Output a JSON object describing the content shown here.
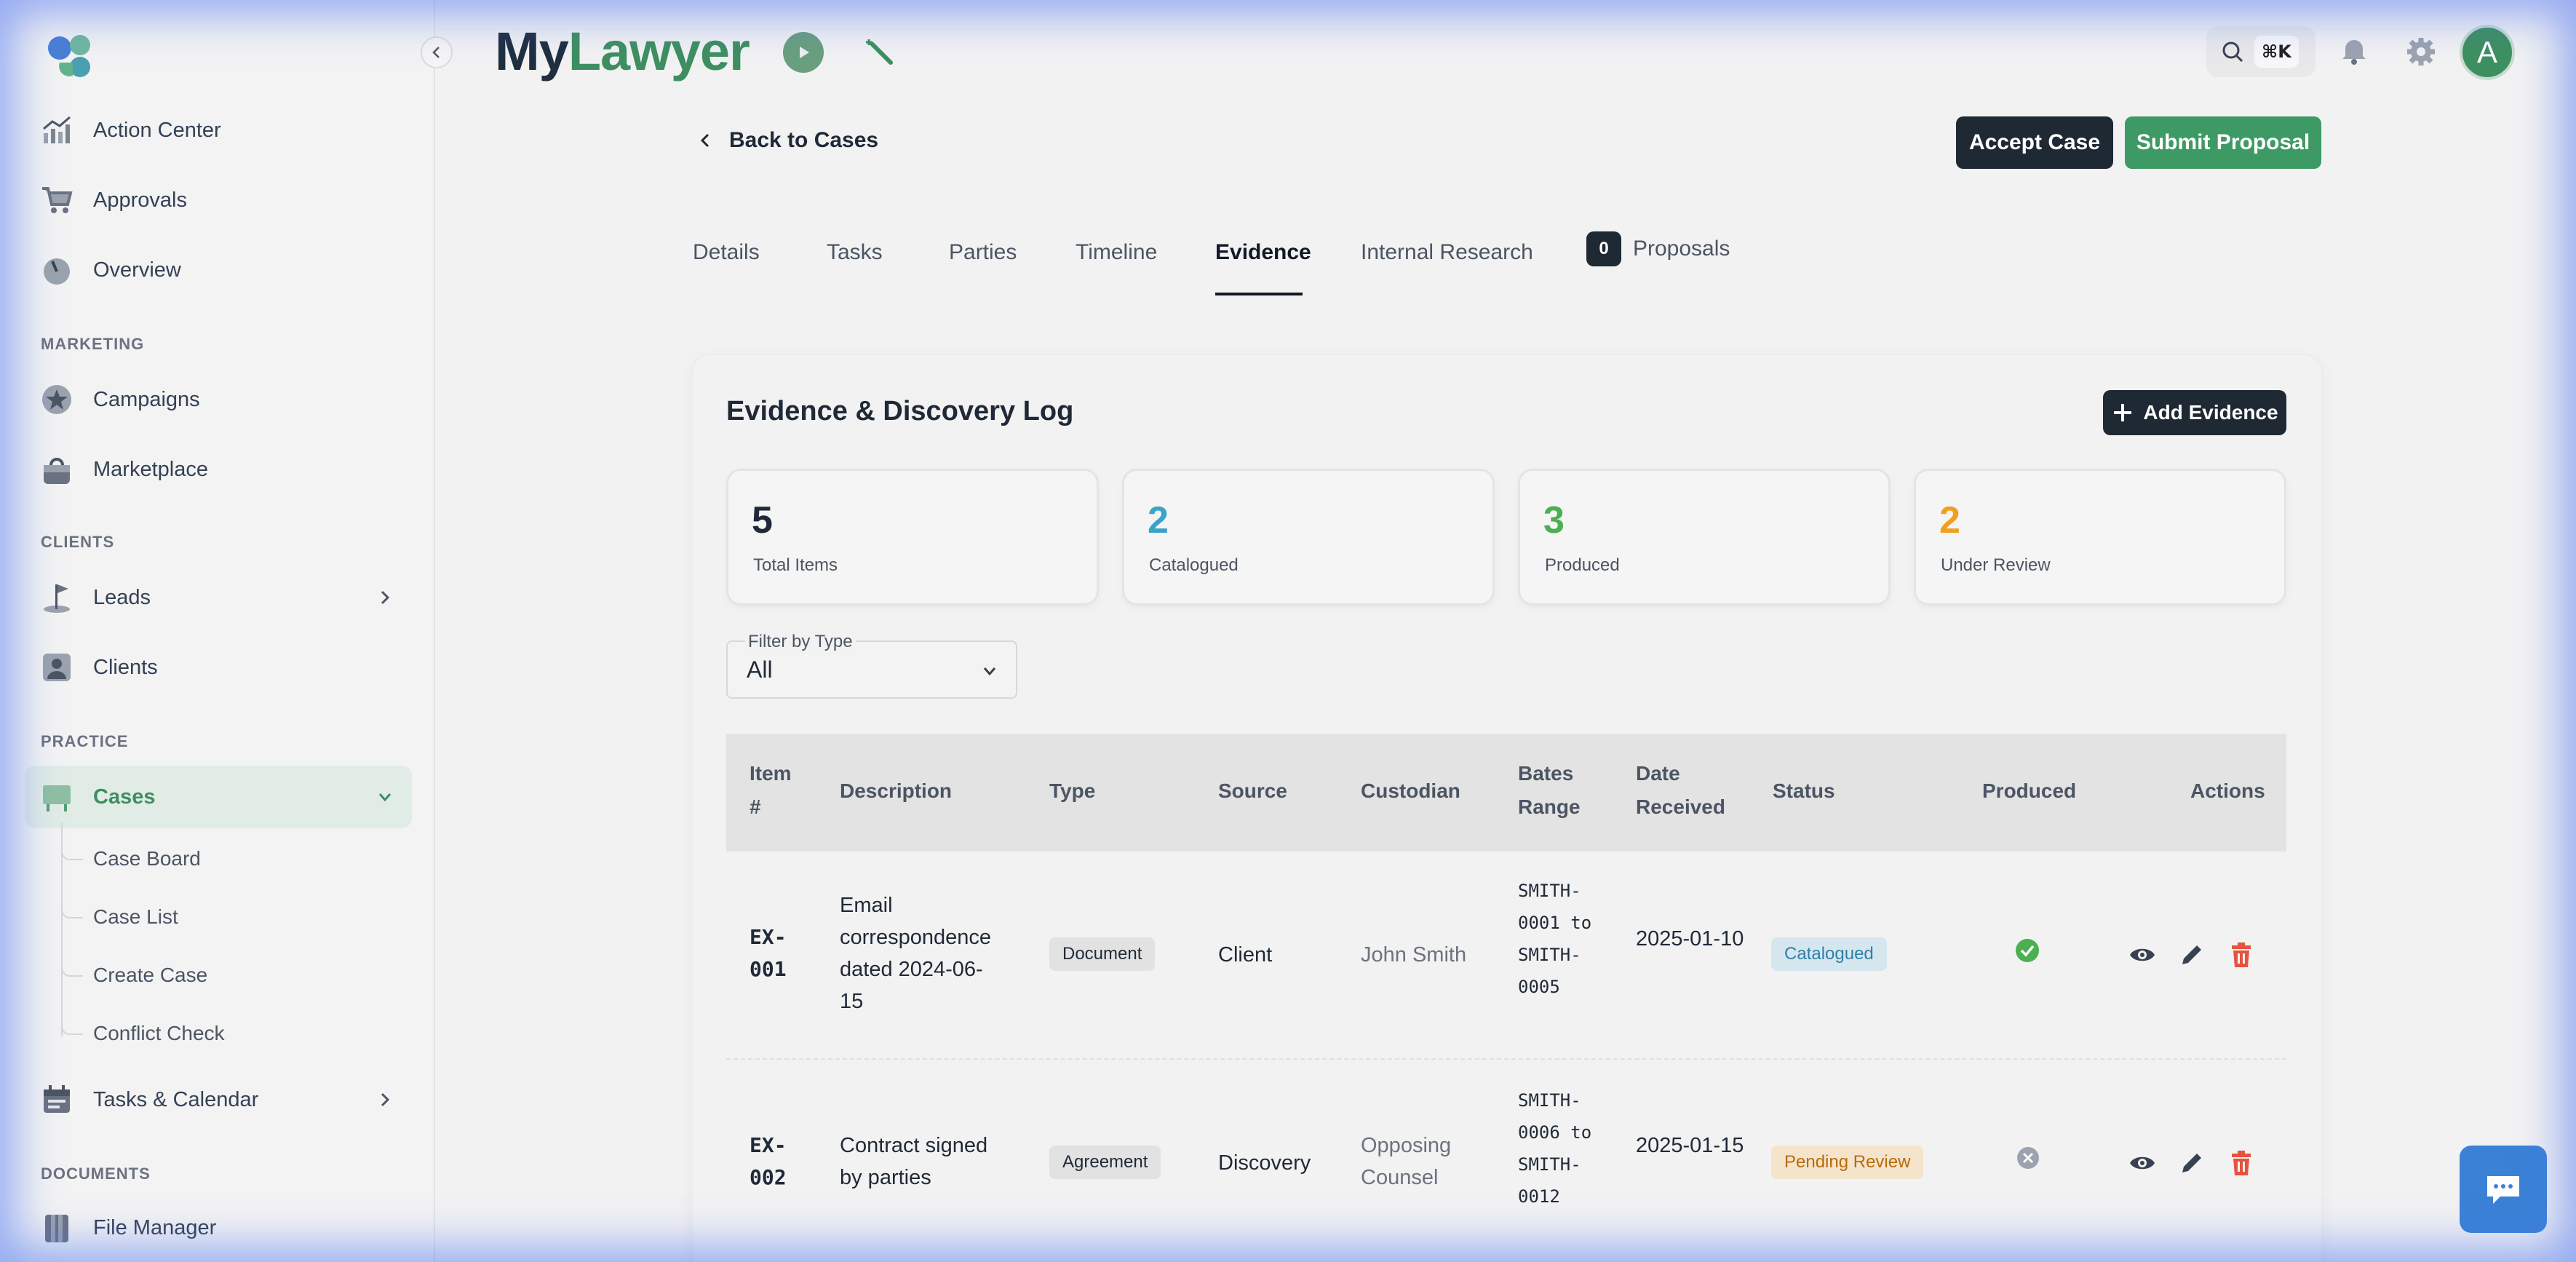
{
  "brand": {
    "part1": "My",
    "part2": "Lawyer"
  },
  "header": {
    "search_shortcut": "⌘K",
    "avatar_initial": "A"
  },
  "sidebar": {
    "items": [
      {
        "label": "Action Center",
        "icon": "chart-icon"
      },
      {
        "label": "Approvals",
        "icon": "cart-icon"
      },
      {
        "label": "Overview",
        "icon": "gauge-icon"
      }
    ],
    "section_marketing": "MARKETING",
    "marketing": [
      {
        "label": "Campaigns",
        "icon": "star-icon"
      },
      {
        "label": "Marketplace",
        "icon": "bag-icon"
      }
    ],
    "section_clients": "CLIENTS",
    "clients": [
      {
        "label": "Leads",
        "icon": "flag-icon"
      },
      {
        "label": "Clients",
        "icon": "person-icon"
      }
    ],
    "section_practice": "PRACTICE",
    "practice": [
      {
        "label": "Cases",
        "icon": "board-icon"
      }
    ],
    "cases_sub": [
      "Case Board",
      "Case List",
      "Create Case",
      "Conflict Check"
    ],
    "tasks": {
      "label": "Tasks & Calendar",
      "icon": "calendar-icon"
    },
    "section_documents": "DOCUMENTS",
    "documents": [
      {
        "label": "File Manager",
        "icon": "folder-icon"
      }
    ]
  },
  "page": {
    "back_label": "Back to Cases",
    "accept_label": "Accept Case",
    "submit_label": "Submit Proposal",
    "tabs": [
      "Details",
      "Tasks",
      "Parties",
      "Timeline",
      "Evidence",
      "Internal Research",
      "Proposals"
    ],
    "active_tab": "Evidence",
    "proposals_count": "0"
  },
  "evidence": {
    "title": "Evidence & Discovery Log",
    "add_label": "Add Evidence",
    "stats": [
      {
        "value": "5",
        "label": "Total Items",
        "color": "#1f2937"
      },
      {
        "value": "2",
        "label": "Catalogued",
        "color": "#3aa3c7"
      },
      {
        "value": "3",
        "label": "Produced",
        "color": "#4caf50"
      },
      {
        "value": "2",
        "label": "Under Review",
        "color": "#f0a020"
      }
    ],
    "filter": {
      "label": "Filter by Type",
      "value": "All"
    },
    "columns": [
      "Item #",
      "Description",
      "Type",
      "Source",
      "Custodian",
      "Bates Range",
      "Date Received",
      "Status",
      "Produced",
      "Actions"
    ],
    "rows": [
      {
        "item": "EX-001",
        "description": "Email correspondence dated 2024-06-15",
        "type": "Document",
        "source": "Client",
        "custodian": "John Smith",
        "bates": "SMITH-0001 to SMITH-0005",
        "date": "2025-01-10",
        "status": "Catalogued",
        "produced": true
      },
      {
        "item": "EX-002",
        "description": "Contract signed by parties",
        "type": "Agreement",
        "source": "Discovery",
        "custodian": "Opposing Counsel",
        "bates": "SMITH-0006 to SMITH-0012",
        "date": "2025-01-15",
        "status": "Pending Review",
        "produced": false
      }
    ]
  }
}
